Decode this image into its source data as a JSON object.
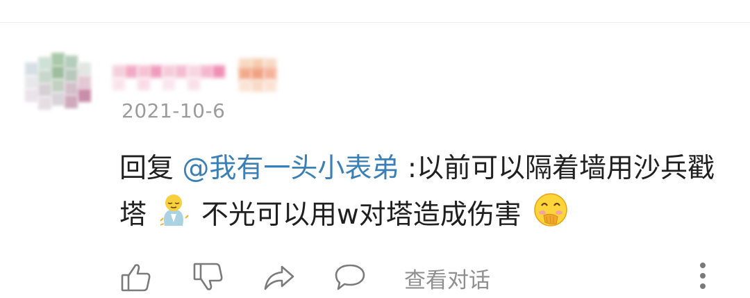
{
  "comment": {
    "timestamp": "2021-10-6",
    "reply_prefix": "回复 ",
    "mention": "@我有一头小表弟",
    "text_part1": " :以前可以隔着墙用沙兵戳塔",
    "text_part2": " 不光可以用w对塔造成伤害",
    "emoji_1": "relieved-praying-emoji",
    "emoji_2": "laughing-covering-mouth-emoji"
  },
  "actions": {
    "like_icon": "thumbs-up-icon",
    "dislike_icon": "thumbs-down-icon",
    "share_icon": "share-arrow-icon",
    "reply_icon": "comment-bubble-icon",
    "view_conversation": "查看对话",
    "more_icon": "more-vertical-icon"
  }
}
